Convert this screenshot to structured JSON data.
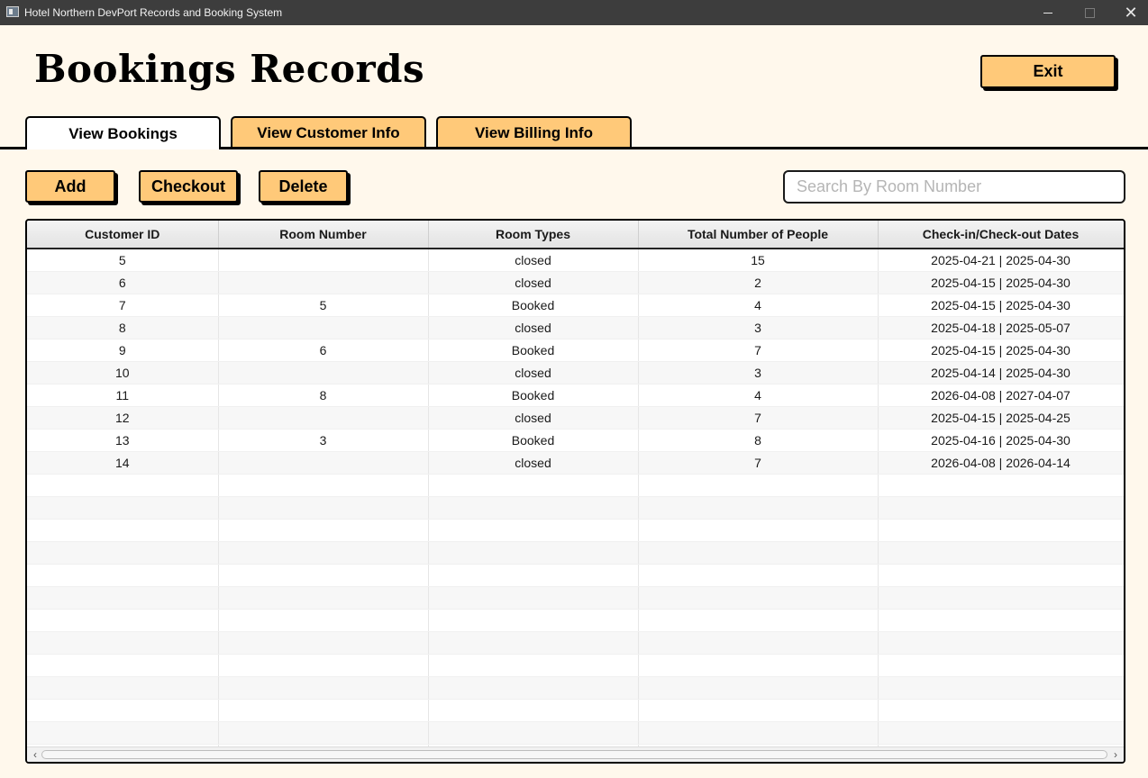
{
  "window": {
    "title": "Hotel Northern DevPort Records and Booking System",
    "minimize_glyph": "",
    "close_glyph": "✕"
  },
  "header": {
    "title": "Bookings Records",
    "exit_label": "Exit"
  },
  "tabs": [
    {
      "label": "View Bookings",
      "active": true
    },
    {
      "label": "View Customer Info",
      "active": false
    },
    {
      "label": "View Billing Info",
      "active": false
    }
  ],
  "toolbar": {
    "add_label": "Add",
    "checkout_label": "Checkout",
    "delete_label": "Delete",
    "search_placeholder": "Search By Room Number",
    "search_value": ""
  },
  "table": {
    "columns": [
      "Customer ID",
      "Room Number",
      "Room Types",
      "Total Number of People",
      "Check-in/Check-out Dates"
    ],
    "rows": [
      [
        "5",
        "",
        "closed",
        "15",
        "2025-04-21 | 2025-04-30"
      ],
      [
        "6",
        "",
        "closed",
        "2",
        "2025-04-15 | 2025-04-30"
      ],
      [
        "7",
        "5",
        "Booked",
        "4",
        "2025-04-15 | 2025-04-30"
      ],
      [
        "8",
        "",
        "closed",
        "3",
        "2025-04-18 | 2025-05-07"
      ],
      [
        "9",
        "6",
        "Booked",
        "7",
        "2025-04-15 | 2025-04-30"
      ],
      [
        "10",
        "",
        "closed",
        "3",
        "2025-04-14 | 2025-04-30"
      ],
      [
        "11",
        "8",
        "Booked",
        "4",
        "2026-04-08 | 2027-04-07"
      ],
      [
        "12",
        "",
        "closed",
        "7",
        "2025-04-15 | 2025-04-25"
      ],
      [
        "13",
        "3",
        "Booked",
        "8",
        "2025-04-16 | 2025-04-30"
      ],
      [
        "14",
        "",
        "closed",
        "7",
        "2026-04-08 | 2026-04-14"
      ]
    ],
    "scroll_left": "‹",
    "scroll_right": "›"
  },
  "colors": {
    "background": "#fff8ec",
    "button": "#ffc979",
    "titlebar": "#3d3d3d"
  }
}
